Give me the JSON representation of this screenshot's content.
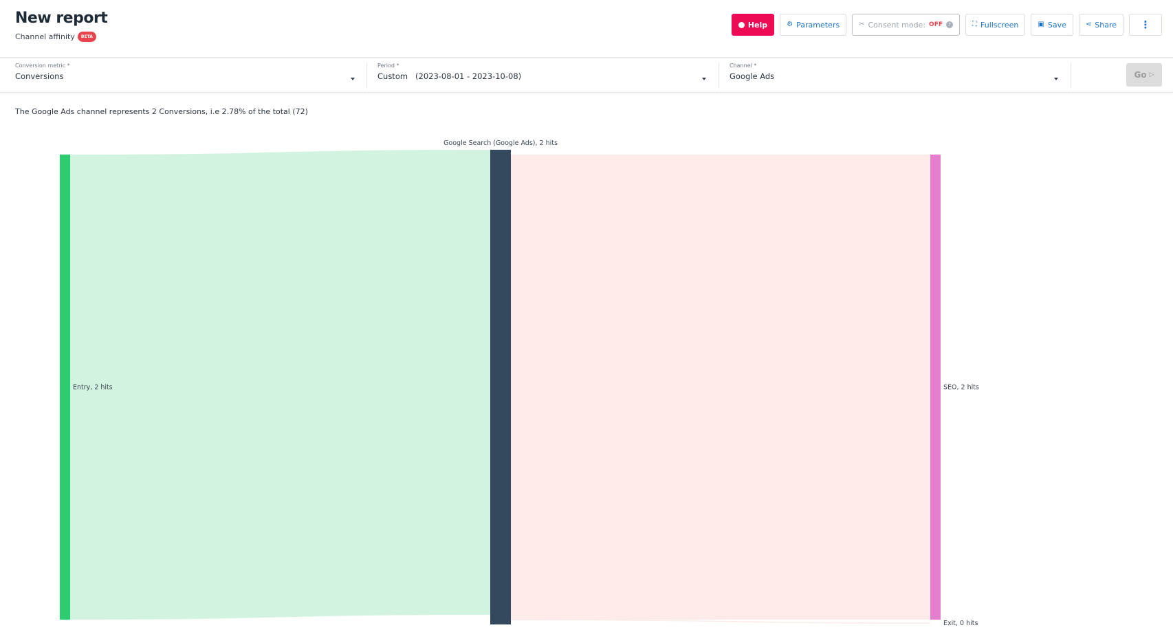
{
  "header": {
    "title": "New report",
    "subtitle": "Channel affinity",
    "badge": "BETA"
  },
  "toolbar": {
    "help": "Help",
    "parameters": "Parameters",
    "consent_label": "Consent mode:",
    "consent_state": "OFF",
    "fullscreen": "Fullscreen",
    "save": "Save",
    "share": "Share",
    "more": "⋮"
  },
  "filters": {
    "conversion_metric": {
      "label": "Conversion metric *",
      "value": "Conversions"
    },
    "period": {
      "label": "Period *",
      "value": "Custom   (2023-08-01 - 2023-10-08)"
    },
    "channel": {
      "label": "Channel *",
      "value": "Google Ads"
    },
    "go": "Go"
  },
  "summary": "The Google Ads channel represents 2 Conversions, i.e 2.78% of the total (72)",
  "chart_data": {
    "type": "sankey",
    "nodes": [
      {
        "id": "entry",
        "label": "Entry, 2 hits",
        "value": 2,
        "column": 0,
        "color": "#2ecc71"
      },
      {
        "id": "google_search",
        "label": "Google Search (Google Ads), 2 hits",
        "value": 2,
        "column": 1,
        "color": "#34495e"
      },
      {
        "id": "seo",
        "label": "SEO, 2 hits",
        "value": 2,
        "column": 2,
        "color": "#e67ecf"
      },
      {
        "id": "exit",
        "label": "Exit, 0 hits",
        "value": 0,
        "column": 2,
        "color": "#e67ecf"
      }
    ],
    "links": [
      {
        "source": "entry",
        "target": "google_search",
        "value": 2,
        "color": "#d3f3e1"
      },
      {
        "source": "google_search",
        "target": "seo",
        "value": 2,
        "color": "#fcebe8"
      },
      {
        "source": "google_search",
        "target": "exit",
        "value": 0,
        "color": "#fcebe8"
      }
    ]
  }
}
